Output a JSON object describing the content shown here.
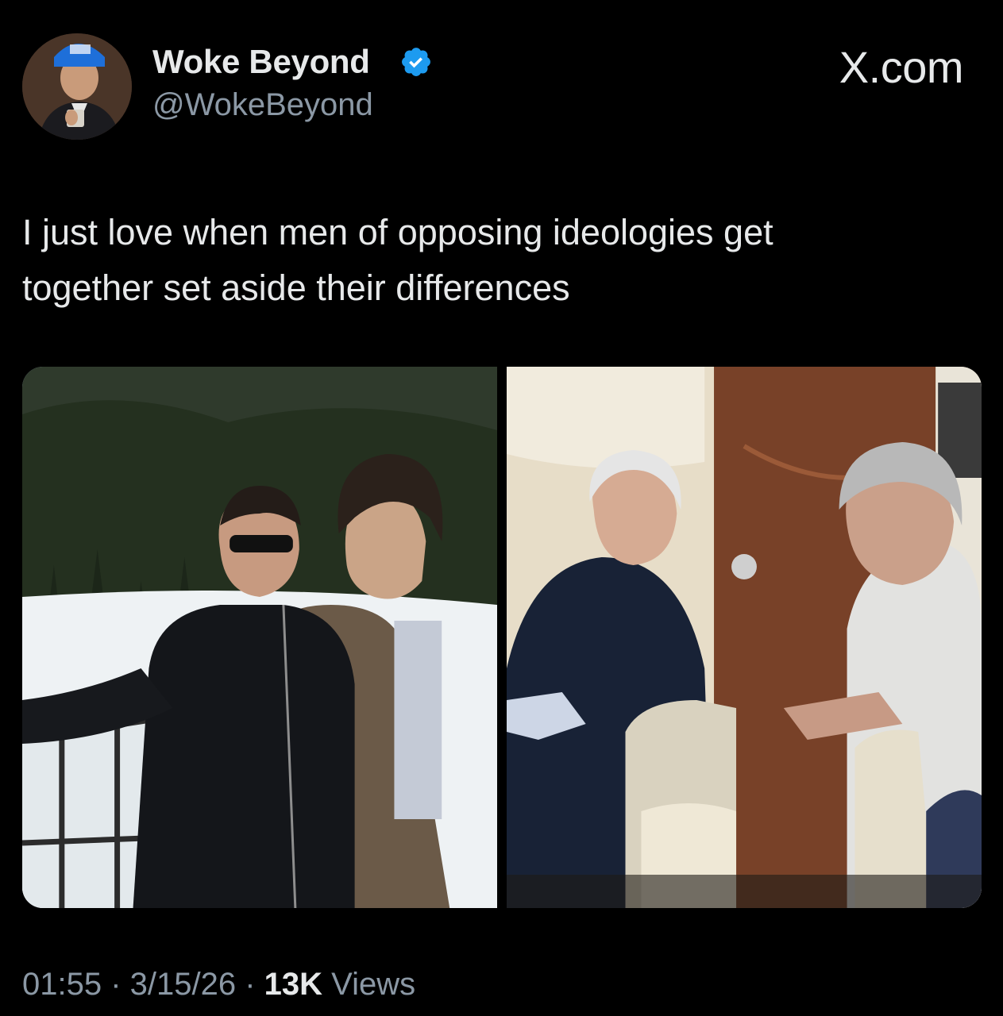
{
  "author": {
    "display_name": "Woke Beyond",
    "handle": "@WokeBeyond",
    "verified_icon": "verified-badge-icon",
    "badge_color": "#1d9bf0"
  },
  "site_label": "X.com",
  "post": {
    "text": "I just love when men of opposing ideologies get\ntogether set aside their differences"
  },
  "media": [
    {
      "name": "photo-left",
      "icon": "photo-two-men-snowy-mountain-balcony"
    },
    {
      "name": "photo-right",
      "icon": "photo-two-men-seated-private-jet-cabin"
    }
  ],
  "meta": {
    "time": "01:55",
    "separator": " · ",
    "date": "3/15/26",
    "views_count": "13K",
    "views_label": " Views"
  },
  "colors": {
    "background": "#000000",
    "primary_text": "#e7e9ea",
    "secondary_text": "#8b98a5"
  }
}
